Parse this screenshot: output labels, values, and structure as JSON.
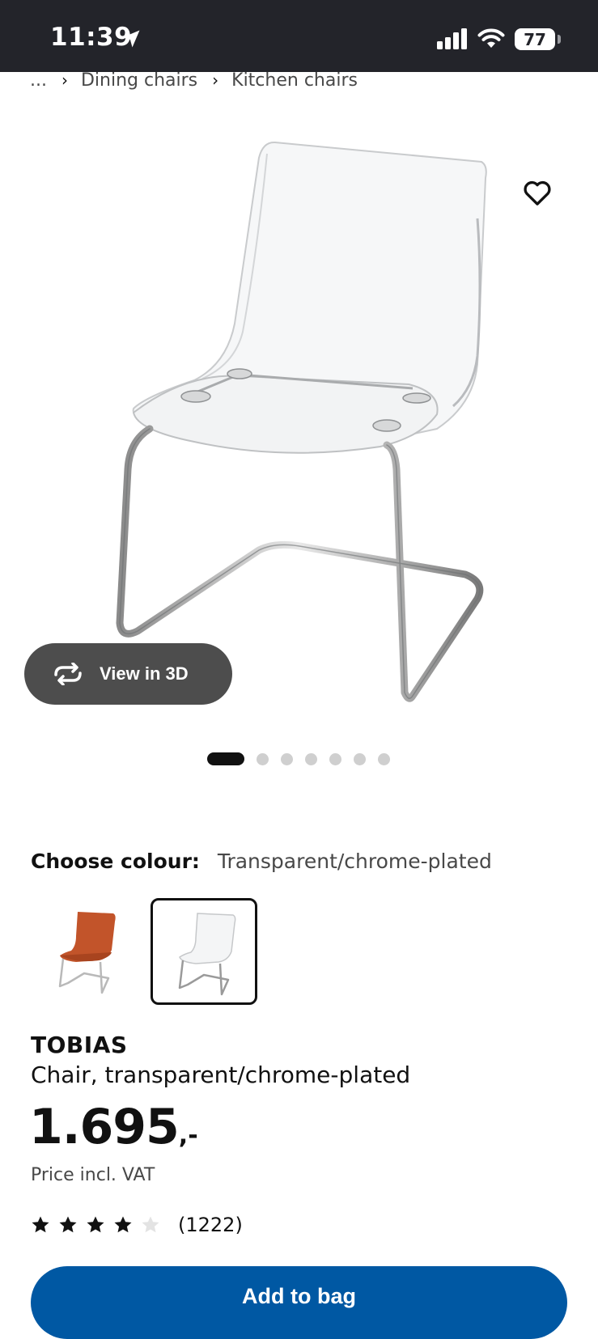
{
  "status_bar": {
    "time": "11:39",
    "battery": "77"
  },
  "breadcrumb": {
    "ellipsis": "...",
    "items": [
      "Dining chairs",
      "Kitchen chairs"
    ]
  },
  "gallery": {
    "view_3d_label": "View in 3D",
    "dot_count": 7,
    "active_index": 0
  },
  "colour": {
    "label": "Choose colour:",
    "selected": "Transparent/chrome-plated",
    "swatches": [
      "orange",
      "transparent"
    ],
    "selected_index": 1
  },
  "product": {
    "brand": "TOBIAS",
    "description": "Chair, transparent/chrome-plated",
    "price": "1.695",
    "price_suffix": ",-",
    "price_note": "Price incl. VAT",
    "rating": 4,
    "rating_max": 5,
    "review_count": "(1222)"
  },
  "actions": {
    "add_to_bag": "Add to bag"
  },
  "colors": {
    "status_bar": "#23242a",
    "primary_button": "#0058a3",
    "pill": "#4d4d4d"
  }
}
